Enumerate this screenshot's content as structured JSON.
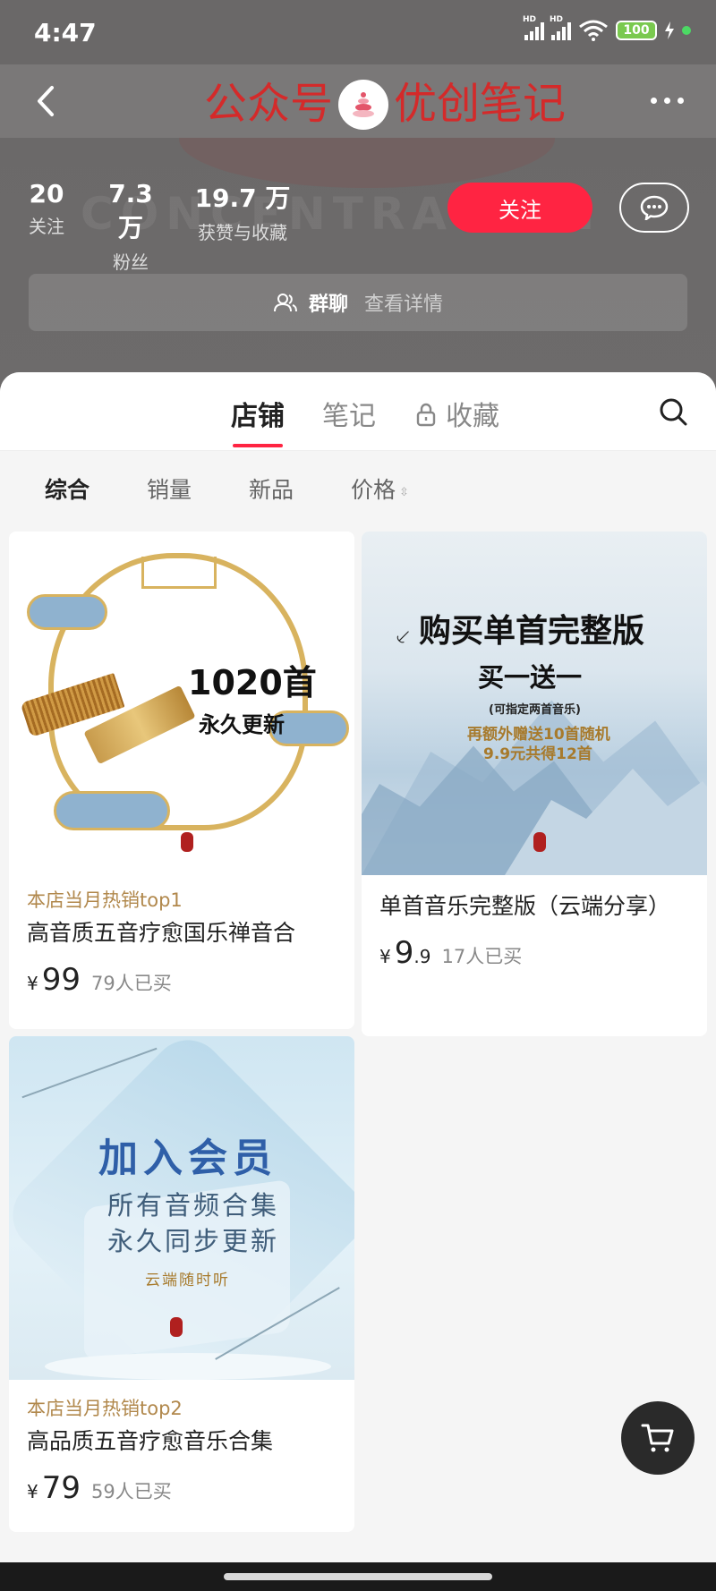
{
  "status_bar": {
    "time": "4:47",
    "signal_1": "HD",
    "signal_2": "HD",
    "battery": "100"
  },
  "navbar": {
    "title_left": "公众号",
    "title_right": "优创笔记",
    "logo_label": "CONCENTRATION"
  },
  "profile": {
    "watermark": "CONCENTRATION",
    "stats": [
      {
        "value": "20",
        "label": "关注"
      },
      {
        "value": "7.3 万",
        "label": "粉丝"
      },
      {
        "value": "19.7 万",
        "label": "获赞与收藏"
      }
    ],
    "follow_label": "关注",
    "group_chat": {
      "label": "群聊",
      "detail": "查看详情"
    }
  },
  "tabs": [
    {
      "label": "店铺",
      "active": true
    },
    {
      "label": "笔记",
      "active": false
    },
    {
      "label": "收藏",
      "active": false,
      "locked": true
    }
  ],
  "sort_options": [
    {
      "label": "综合",
      "active": true
    },
    {
      "label": "销量",
      "active": false
    },
    {
      "label": "新品",
      "active": false
    },
    {
      "label": "价格",
      "active": false
    }
  ],
  "products": [
    {
      "tagline": "本店当月热销top1",
      "title": "高音质五音疗愈国乐禅音合",
      "price_int": "99",
      "price_dec": "",
      "sold": "79人已买",
      "image_text": {
        "big": "1020首",
        "small": "永久更新"
      }
    },
    {
      "tagline": "",
      "title": "单首音乐完整版（云端分享）",
      "price_int": "9",
      "price_dec": ".9",
      "sold": "17人已买",
      "image_text": {
        "line1": "购买单首完整版",
        "line2": "买一送一",
        "line3": "(可指定两首音乐)",
        "line4": "再额外赠送10首随机",
        "line5": "9.9元共得12首"
      }
    },
    {
      "tagline": "本店当月热销top2",
      "title": "高品质五音疗愈音乐合集",
      "price_int": "79",
      "price_dec": "",
      "sold": "59人已买",
      "image_text": {
        "line1": "加入会员",
        "line2": "所有音频合集",
        "line3": "永久同步更新",
        "line4": "云端随时听"
      }
    }
  ],
  "currency": "¥",
  "colors": {
    "accent": "#ff2442",
    "tagline": "#b1884c",
    "dark_fab": "#2a2a2a"
  }
}
